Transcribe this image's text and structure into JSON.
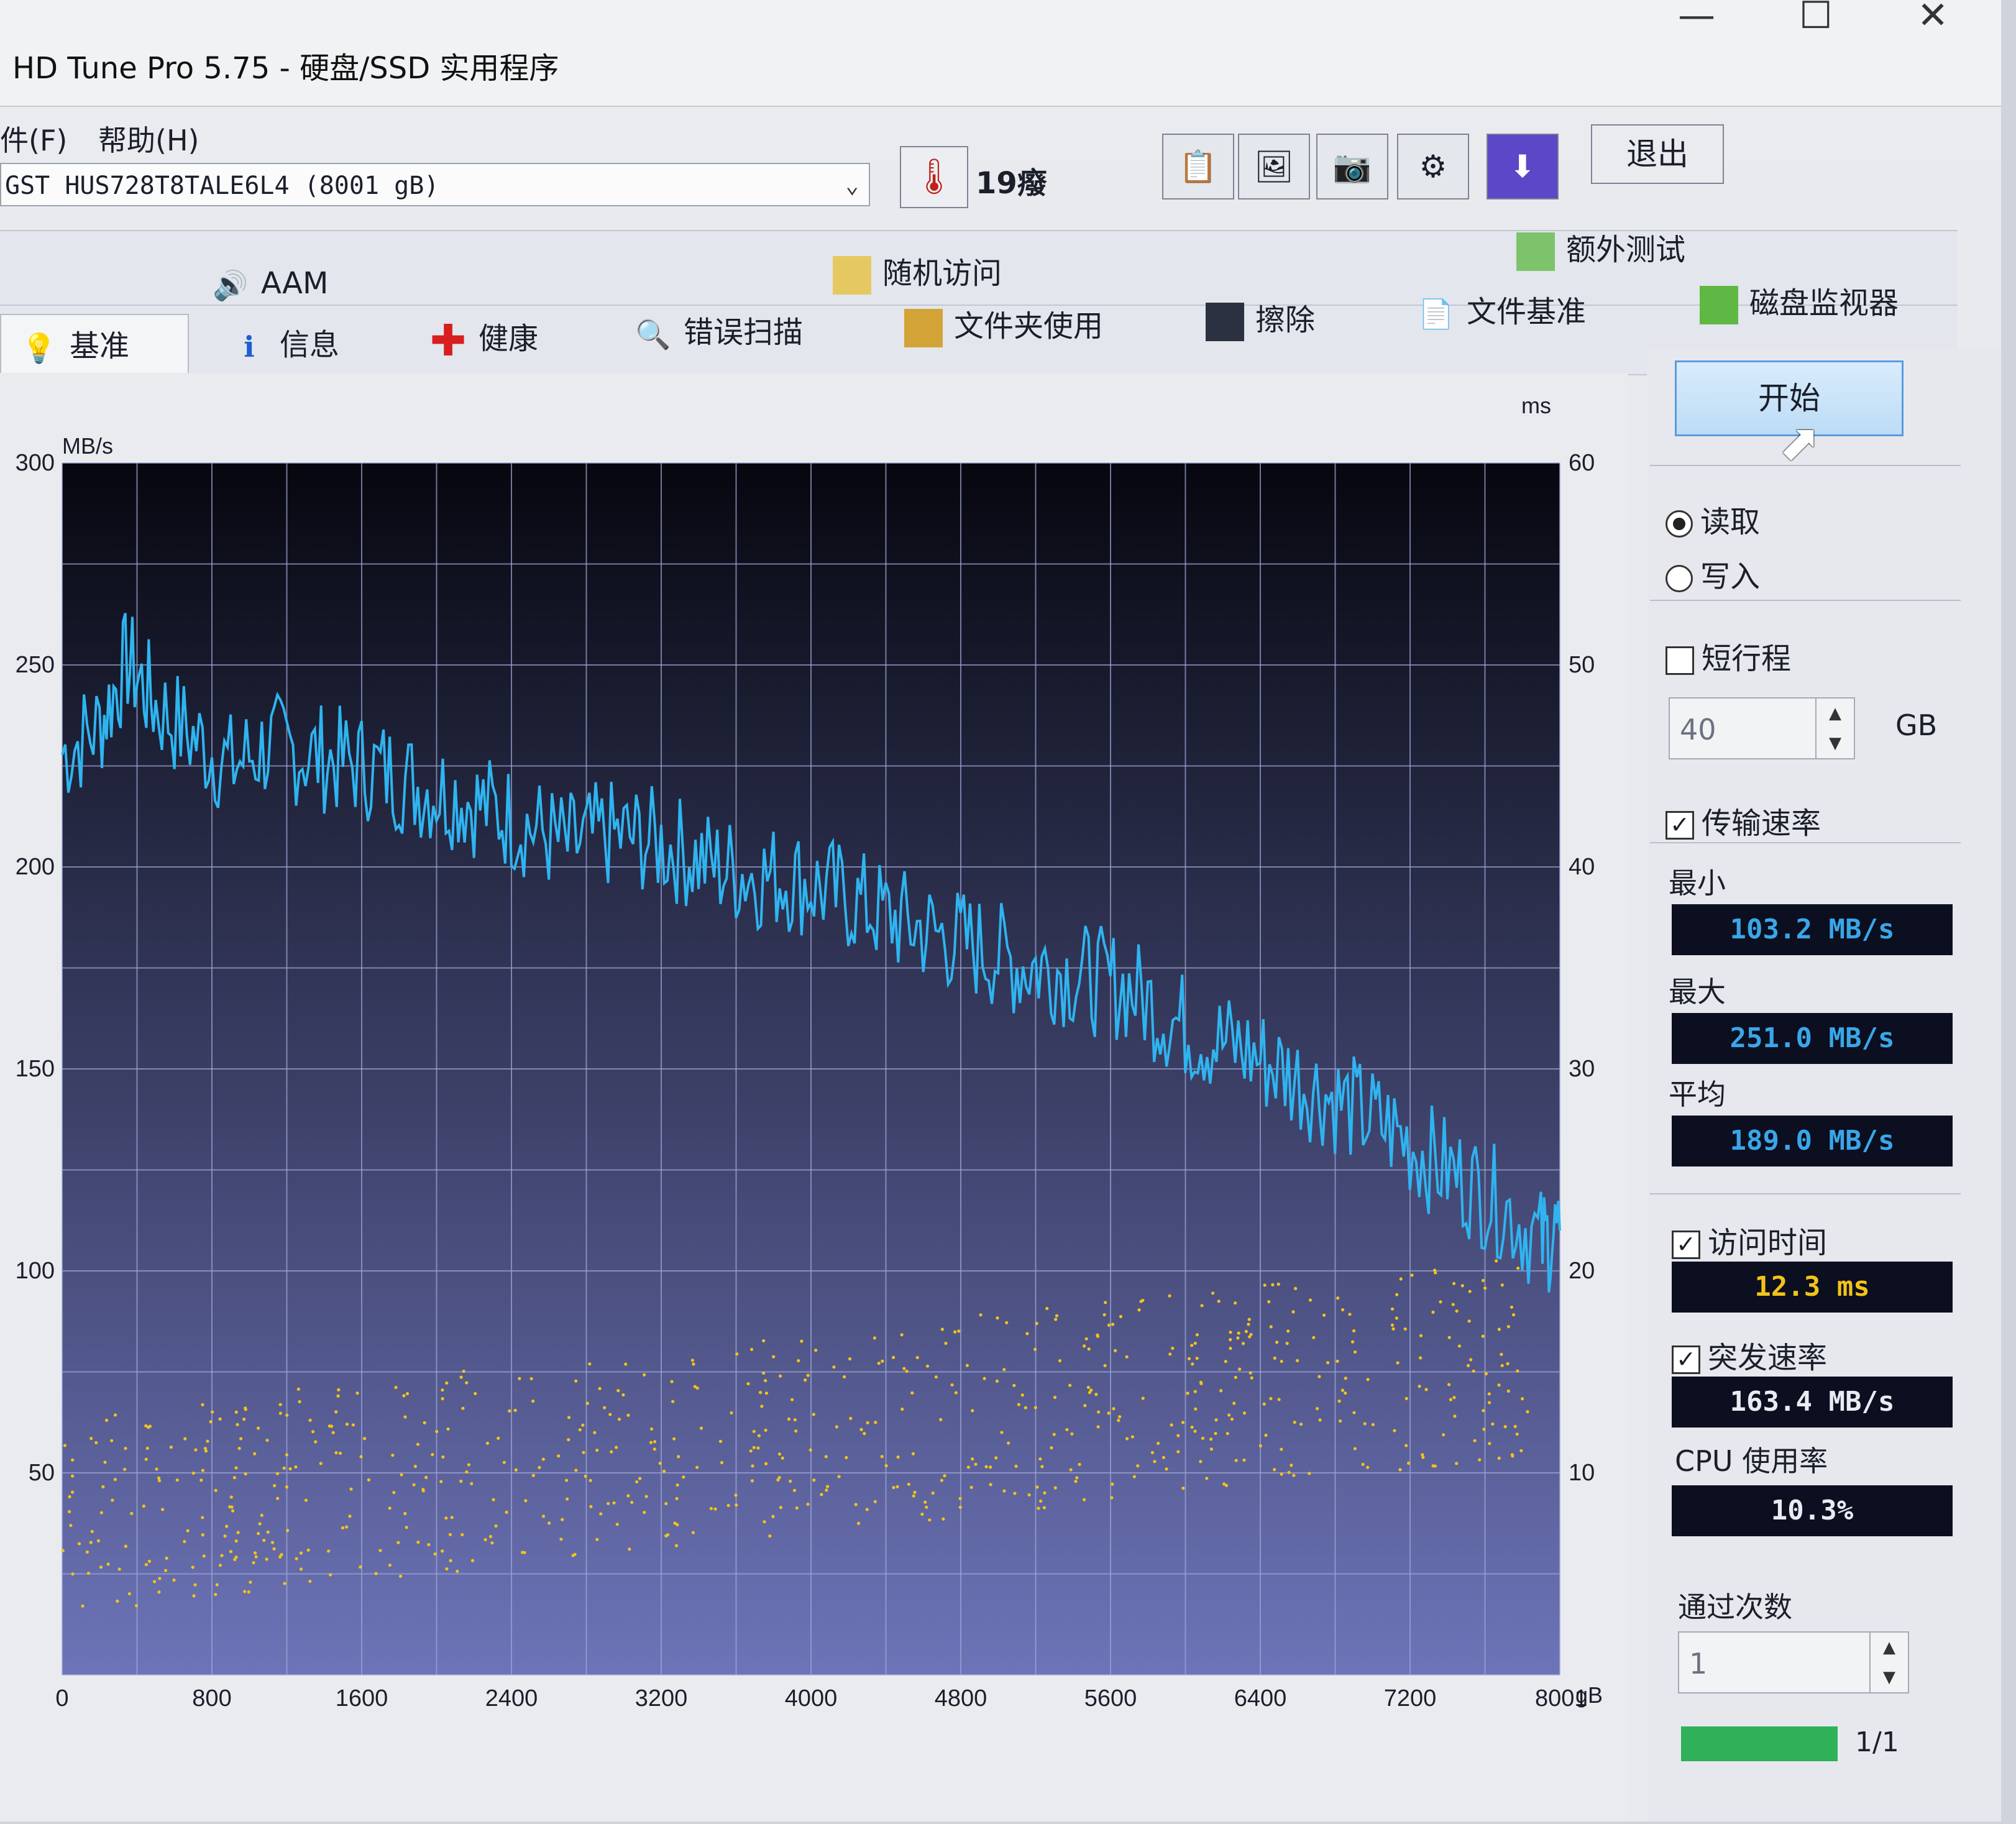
{
  "window": {
    "title": "HD Tune Pro 5.75 - 硬盘/SSD 实用程序",
    "controls": [
      "—",
      "☐",
      "✕"
    ]
  },
  "menu": [
    "件(F)",
    "帮助(H)"
  ],
  "drive": {
    "selected": "GST HUS728T8TALE6L4 (8001 gB)"
  },
  "temperature": "19癈",
  "toolbar": {
    "exit_label": "退出"
  },
  "tabs_row1": [
    "AAM",
    "随机访问",
    "额外测试"
  ],
  "tabs_row2": [
    "基准",
    "信息",
    "健康",
    "错误扫描",
    "文件夹使用",
    "擦除",
    "文件基准",
    "磁盘监视器"
  ],
  "active_tab": "基准",
  "panel": {
    "start_label": "开始",
    "read_label": "读取",
    "write_label": "写入",
    "mode_selected": "read",
    "short_stroke_label": "短行程",
    "short_stroke_checked": false,
    "short_stroke_value": "40",
    "short_stroke_unit": "GB",
    "transfer_rate_label": "传输速率",
    "min_label": "最小",
    "min_value": "103.2 MB/s",
    "max_label": "最大",
    "max_value": "251.0 MB/s",
    "avg_label": "平均",
    "avg_value": "189.0 MB/s",
    "access_time_label": "访问时间",
    "access_time_value": "12.3 ms",
    "burst_label": "突发速率",
    "burst_value": "163.4 MB/s",
    "cpu_label": "CPU 使用率",
    "cpu_value": "10.3%",
    "passes_label": "通过次数",
    "passes_value": "1",
    "progress_text": "1/1",
    "progress_fraction": 1.0
  },
  "chart_data": {
    "type": "line",
    "ylabel_left": "MB/s",
    "ylabel_right": "ms",
    "xlabel_unit": "gB",
    "x_ticks": [
      "0",
      "800",
      "1600",
      "2400",
      "3200",
      "4000",
      "4800",
      "5600",
      "6400",
      "7200",
      "8001"
    ],
    "y_left_ticks": [
      "300",
      "250",
      "200",
      "150",
      "100",
      "50"
    ],
    "y_right_ticks": [
      "60",
      "50",
      "40",
      "30",
      "20",
      "10"
    ],
    "xlim": [
      0,
      8001
    ],
    "ylim_left": [
      0,
      300
    ],
    "ylim_right": [
      0,
      60
    ],
    "grid": true,
    "series": [
      {
        "name": "传输速率",
        "color": "#2fb4f0",
        "x": [
          0,
          200,
          350,
          500,
          700,
          900,
          1100,
          1300,
          1500,
          1700,
          1900,
          2100,
          2300,
          2500,
          2700,
          2900,
          3100,
          3300,
          3500,
          3700,
          3900,
          4100,
          4300,
          4500,
          4700,
          4900,
          5100,
          5300,
          5500,
          5700,
          5900,
          6100,
          6300,
          6500,
          6700,
          6900,
          7100,
          7300,
          7500,
          7700,
          7900,
          8001
        ],
        "y": [
          228,
          235,
          251,
          240,
          232,
          225,
          230,
          228,
          226,
          224,
          220,
          218,
          214,
          210,
          205,
          208,
          207,
          204,
          200,
          198,
          197,
          194,
          190,
          186,
          183,
          180,
          176,
          175,
          172,
          170,
          163,
          158,
          155,
          150,
          145,
          140,
          135,
          128,
          122,
          116,
          107,
          110
        ]
      },
      {
        "name": "访问时间",
        "color": "#f3c318",
        "type": "scatter",
        "x_range": [
          0,
          8001
        ],
        "y_range_ms": [
          5,
          20
        ],
        "mean": 12.3
      }
    ]
  },
  "colors": {
    "plot_top": "#06070f",
    "plot_bottom": "#6d74b8",
    "grid": "#9fa8d8",
    "transfer_line": "#2fb4f0",
    "access_dots": "#f3c318"
  }
}
